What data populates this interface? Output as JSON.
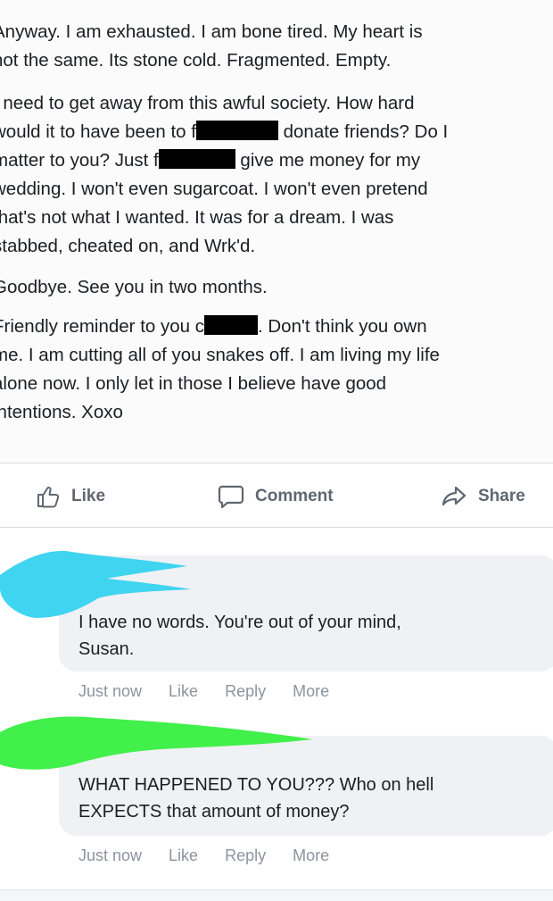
{
  "post": {
    "paragraphs": [
      [
        "Anyway. I am exhausted. I am bone tired. My heart is",
        "not the same. Its stone cold. Fragmented. Empty."
      ],
      [
        "I need to get away from this awful society. How hard",
        "would it to have been to f",
        " donate friends? Do I",
        "matter to you? Just f",
        " give me money for my",
        "wedding. I won't even sugarcoat. I won't even pretend",
        "that's not what I wanted. It was for a dream. I was",
        "stabbed, cheated on, and Wrk'd."
      ],
      [
        "Goodbye. See you in two months."
      ],
      [
        "Friendly reminder to you c",
        ". Don't think you own",
        "me. I am cutting all of you snakes off. I am living my life",
        "alone now. I only let in those I believe have good",
        "intentions. Xoxo"
      ]
    ]
  },
  "actions": {
    "like": "Like",
    "comment": "Comment",
    "share": "Share"
  },
  "comments": [
    {
      "lines": [
        "I have no words. You're out of your mind,",
        "Susan."
      ],
      "time": "Just now",
      "like": "Like",
      "reply": "Reply",
      "more": "More",
      "scribble_color": "#3fd4f0"
    },
    {
      "lines": [
        "WHAT HAPPENED TO YOU??? Who on hell",
        "EXPECTS that amount of money?"
      ],
      "time": "Just now",
      "like": "Like",
      "reply": "Reply",
      "more": "More",
      "scribble_color": "#41f04a"
    }
  ],
  "icons": {
    "like": "thumbs-up-icon",
    "comment": "speech-bubble-icon",
    "share": "share-arrow-icon"
  }
}
